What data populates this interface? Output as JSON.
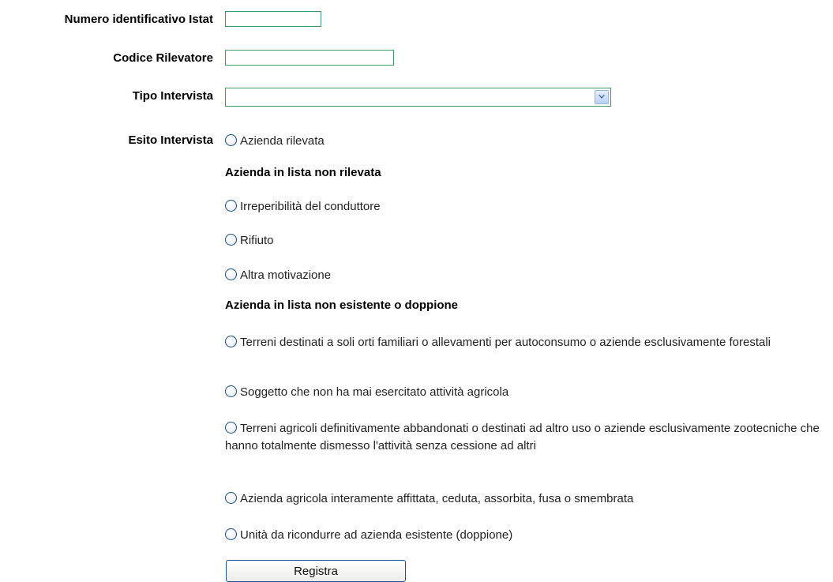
{
  "form": {
    "istat_label": "Numero identificativo Istat",
    "istat_value": "",
    "rilevatore_label": "Codice Rilevatore",
    "rilevatore_value": "",
    "tipo_label": "Tipo Intervista",
    "tipo_value": "",
    "esito_label": "Esito Intervista"
  },
  "esito": {
    "rilevata": "Azienda rilevata",
    "non_rilevata_heading": "Azienda in lista non rilevata",
    "irreperibilita": "Irreperibilità del conduttore",
    "rifiuto": "Rifiuto",
    "altra": "Altra motivazione",
    "non_esistente_heading": "Azienda in lista non esistente o doppione",
    "terreni_orti": "Terreni destinati a soli orti familiari o allevamenti per autoconsumo o aziende esclusivamente forestali",
    "soggetto": "Soggetto che non ha mai esercitato attività agricola",
    "terreni_abbandonati": "Terreni agricoli definitivamente abbandonati o destinati ad altro uso o aziende esclusivamente zootecniche che hanno totalmente dismesso l'attività senza cessione ad altri",
    "affittata": "Azienda agricola interamente affittata, ceduta, assorbita, fusa o smembrata",
    "doppione": "Unità da ricondurre ad azienda esistente (doppione)"
  },
  "actions": {
    "registra": "Registra"
  }
}
